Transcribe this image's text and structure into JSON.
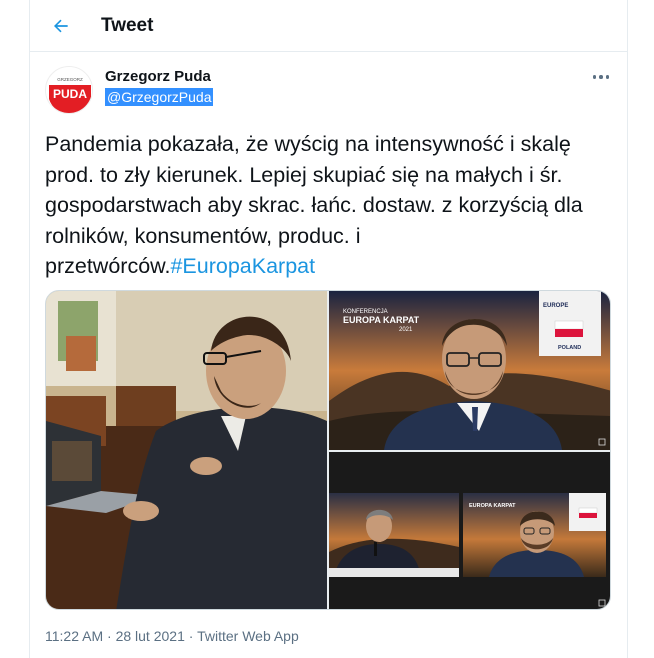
{
  "header": {
    "title": "Tweet"
  },
  "author": {
    "name": "Grzegorz Puda",
    "handle": "@GrzegorzPuda",
    "avatar_top_text": "GRZEGORZ",
    "avatar_main_text": "PUDA"
  },
  "tweet": {
    "text": "Pandemia pokazała, że wyścig na intensywność i skalę prod. to zły kierunek. Lepiej skupiać się na małych i śr. gospodarstwach aby skrac. łańc. dostaw. z korzyścią dla rolników, konsumentów, produc. i przetwórców.",
    "hashtag": "#EuropaKarpat"
  },
  "media": {
    "conference_line1": "KONFERENCJA",
    "conference_line2": "EUROPA KARPAT",
    "conference_year": "2021",
    "flag_label": "POLAND",
    "badge_text": "EUROPE"
  },
  "meta": {
    "time": "11:22 AM",
    "separator": "·",
    "date": "28 lut 2021",
    "app": "Twitter Web App"
  },
  "colors": {
    "accent": "#1b95e0",
    "avatar_red": "#e31e24"
  }
}
